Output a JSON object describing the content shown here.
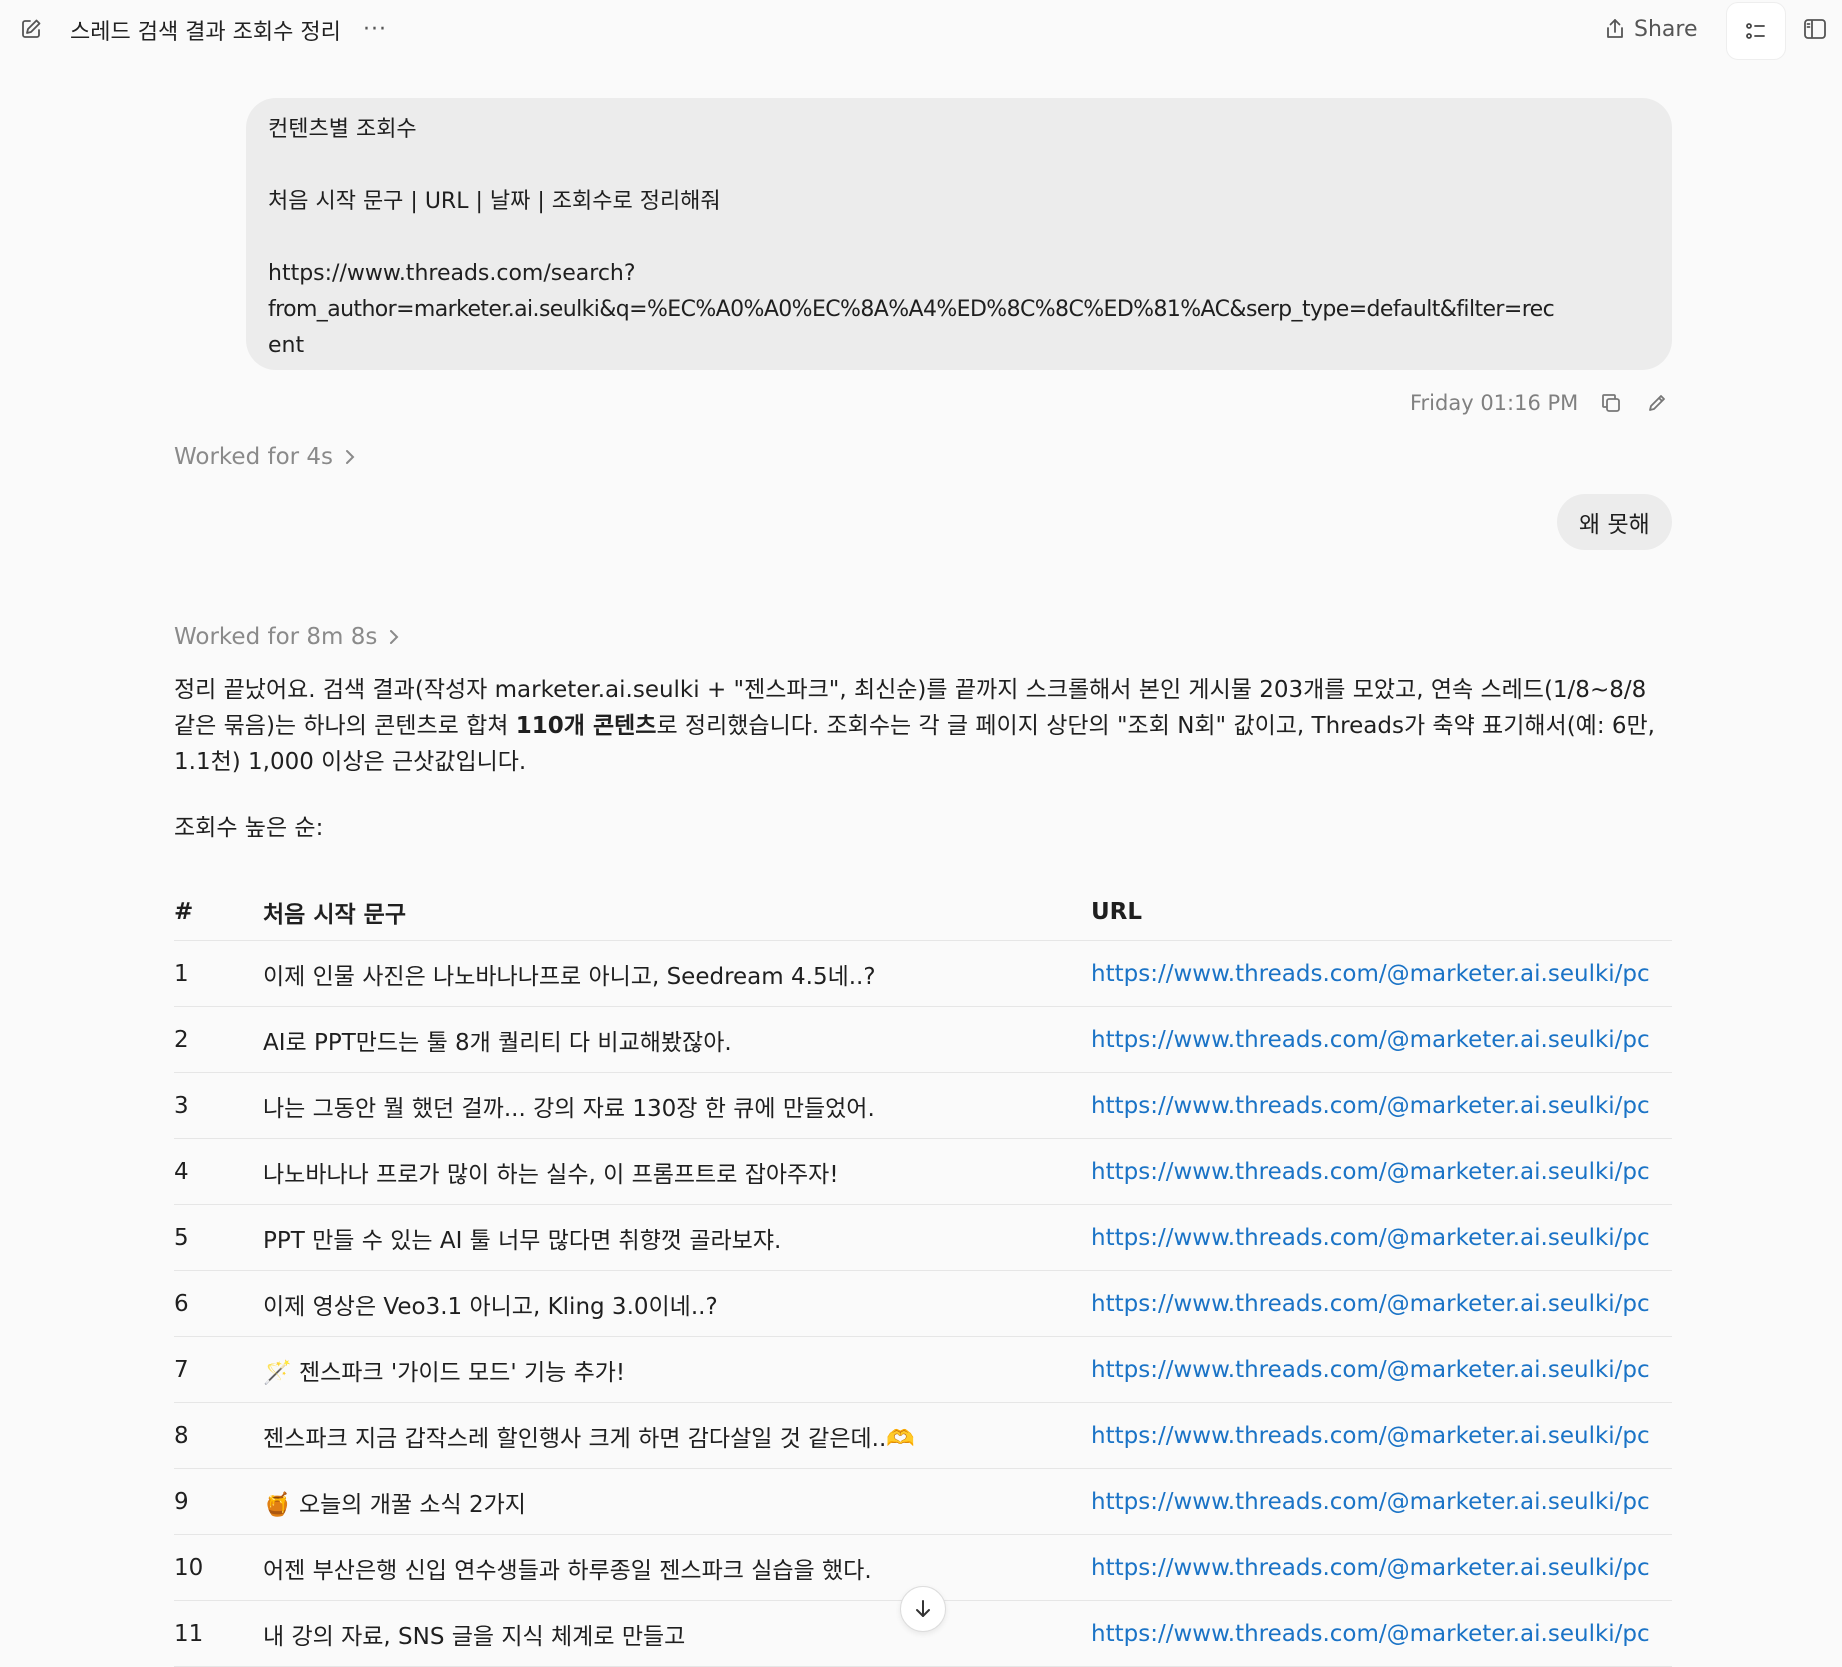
{
  "header": {
    "title": "스레드 검색 결과 조회수 정리",
    "more_label": "···",
    "share_label": "Share"
  },
  "user_message_1": {
    "lines": [
      "컨텐츠별 조회수",
      "",
      "처음 시작 문구 | URL | 날짜 | 조회수로 정리해줘",
      "",
      "https://www.threads.com/search?",
      "from_author=marketer.ai.seulki&q=%EC%A0%A0%EC%8A%A4%ED%8C%8C%ED%81%AC&serp_type=default&filter=rec",
      "ent"
    ],
    "timestamp": "Friday 01:16 PM"
  },
  "worked_1": "Worked for 4s",
  "user_message_2": "왜 못해",
  "worked_2": "Worked for 8m 8s",
  "answer": {
    "part1": "정리 끝났어요. 검색 결과(작성자 marketer.ai.seulki + \"젠스파크\", 최신순)를 끝까지 스크롤해서 본인 게시물 203개를 모았고, 연속 스레드(1/8~8/8 같은 묶음)는 하나의 콘텐츠로 합쳐 ",
    "bold": "110개 콘텐츠",
    "part2": "로 정리했습니다. 조회수는 각 글 페이지 상단의 \"조회 N회\" 값이고, Threads가 축약 표기해서(예: 6만, 1.1천) 1,000 이상은 근삿값입니다.",
    "subheading": "조회수 높은 순:"
  },
  "table": {
    "headers": [
      "#",
      "처음 시작 문구",
      "URL"
    ],
    "rows": [
      {
        "num": "1",
        "text": "이제 인물 사진은 나노바나나프로 아니고, Seedream 4.5네..?",
        "url": "https://www.threads.com/@marketer.ai.seulki/pc"
      },
      {
        "num": "2",
        "text": "AI로 PPT만드는 툴 8개 퀄리티 다 비교해봤잖아.",
        "url": "https://www.threads.com/@marketer.ai.seulki/pc"
      },
      {
        "num": "3",
        "text": "나는 그동안 뭘 했던 걸까... 강의 자료 130장 한 큐에 만들었어.",
        "url": "https://www.threads.com/@marketer.ai.seulki/pc"
      },
      {
        "num": "4",
        "text": "나노바나나 프로가 많이 하는 실수, 이 프롬프트로 잡아주자!",
        "url": "https://www.threads.com/@marketer.ai.seulki/pc"
      },
      {
        "num": "5",
        "text": "PPT 만들 수 있는 AI 툴 너무 많다면 취향껏 골라보쟈.",
        "url": "https://www.threads.com/@marketer.ai.seulki/pc"
      },
      {
        "num": "6",
        "text": "이제 영상은 Veo3.1 아니고, Kling 3.0이네..?",
        "url": "https://www.threads.com/@marketer.ai.seulki/pc"
      },
      {
        "num": "7",
        "text": "🪄 젠스파크 '가이드 모드' 기능 추가!",
        "url": "https://www.threads.com/@marketer.ai.seulki/pc"
      },
      {
        "num": "8",
        "text": "젠스파크 지금 갑작스레 할인행사 크게 하면 감다살일 것 같은데..🫶",
        "url": "https://www.threads.com/@marketer.ai.seulki/pc"
      },
      {
        "num": "9",
        "text": "🍯 오늘의 개꿀 소식 2가지",
        "url": "https://www.threads.com/@marketer.ai.seulki/pc"
      },
      {
        "num": "10",
        "text": "어젠 부산은행 신입 연수생들과 하루종일 젠스파크 실습을 했다.",
        "url": "https://www.threads.com/@marketer.ai.seulki/pc"
      },
      {
        "num": "11",
        "text": "내 강의 자료, SNS 글을 지식 체계로 만들고",
        "url": "https://www.threads.com/@marketer.ai.seulki/pc"
      }
    ]
  },
  "icons": {
    "new_chat": "edit-icon",
    "share": "share-icon",
    "toc": "list-icon",
    "panel": "sidebar-panel-icon",
    "copy": "copy-icon",
    "edit": "pencil-icon",
    "chevron": "chevron-right-icon",
    "scroll_down": "arrow-down-icon"
  },
  "colors": {
    "background": "#fafafa",
    "bubble": "#ececec",
    "link": "#1a73c6",
    "muted": "#8a8a8a"
  }
}
